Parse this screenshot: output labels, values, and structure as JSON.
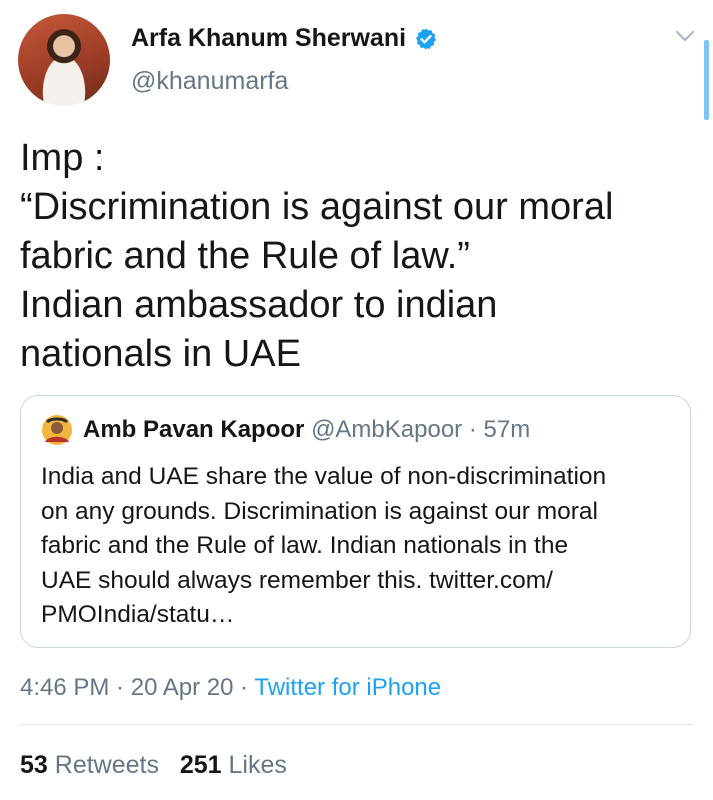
{
  "author": {
    "name": "Arfa Khanum Sherwani",
    "handle": "@khanumarfa",
    "verified_icon": "verified-badge-icon"
  },
  "tweet": {
    "lines": [
      "Imp :",
      "“Discrimination is against our moral",
      "fabric and the Rule of law.”",
      "Indian ambassador to indian",
      "nationals in UAE"
    ]
  },
  "quoted": {
    "name": "Amb Pavan Kapoor",
    "handle": "@AmbKapoor",
    "sep": " · ",
    "time": "57m",
    "lines": [
      "India and UAE share the value of non-discrimination",
      "on any grounds.  Discrimination is against our moral",
      "fabric and the Rule of law. Indian nationals in the",
      "UAE should always remember this. twitter.com/",
      "PMOIndia/statu…"
    ]
  },
  "meta": {
    "time": "4:46 PM",
    "sep1": " · ",
    "date": "20 Apr 20",
    "sep2": " · ",
    "source": "Twitter for iPhone"
  },
  "stats": {
    "retweets_count": "53",
    "retweets_label": "Retweets",
    "likes_count": "251",
    "likes_label": "Likes"
  },
  "colors": {
    "accent": "#1da1f2",
    "secondary_text": "#657786",
    "border": "#ccd6dd"
  }
}
